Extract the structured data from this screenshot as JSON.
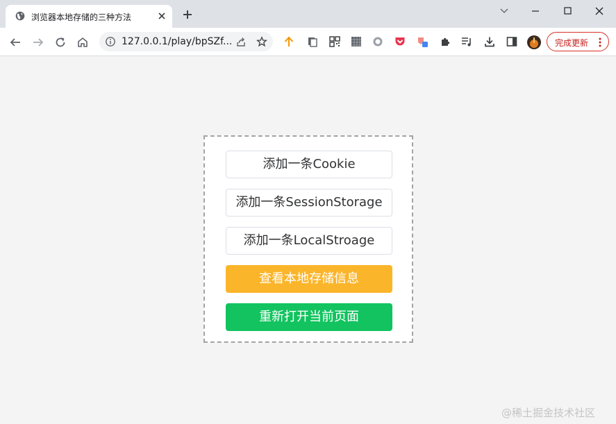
{
  "browser": {
    "tab": {
      "title": "浏览器本地存储的三种方法",
      "favicon": "globe-icon"
    },
    "address_bar": {
      "url": "127.0.0.1/play/bpSZf..."
    },
    "update_button": {
      "label": "完成更新"
    }
  },
  "page": {
    "buttons": [
      {
        "label": "添加一条Cookie",
        "style": "plain"
      },
      {
        "label": "添加一条SessionStorage",
        "style": "plain"
      },
      {
        "label": "添加一条LocalStroage",
        "style": "plain"
      },
      {
        "label": "查看本地存储信息",
        "style": "warning"
      },
      {
        "label": "重新打开当前页面",
        "style": "success"
      }
    ],
    "watermark": "@稀土掘金技术社区"
  },
  "colors": {
    "warning": "#fbb52a",
    "success": "#12c35f",
    "update_accent": "#d93025"
  }
}
